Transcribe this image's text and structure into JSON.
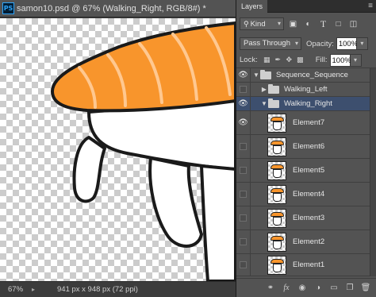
{
  "document": {
    "app_icon": "PS",
    "title": "samon10.psd @ 67% (Walking_Right, RGB/8#) *",
    "zoom": "67%",
    "size_info": "941 px x 948 px (72 ppi)"
  },
  "panel": {
    "tab_label": "Layers",
    "filter": {
      "kind_label": "Kind"
    },
    "blend": {
      "mode": "Pass Through",
      "opacity_label": "Opacity:",
      "opacity_value": "100%",
      "lock_label": "Lock:",
      "fill_label": "Fill:",
      "fill_value": "100%"
    },
    "layers": [
      {
        "name": "Sequence_Sequence",
        "type": "group",
        "expanded": true,
        "visible": true,
        "indent": 0,
        "selected": false
      },
      {
        "name": "Walking_Left",
        "type": "group",
        "expanded": false,
        "visible": false,
        "indent": 1,
        "selected": false
      },
      {
        "name": "Walking_Right",
        "type": "group",
        "expanded": true,
        "visible": true,
        "indent": 1,
        "selected": true
      },
      {
        "name": "Element7",
        "type": "layer",
        "visible": true,
        "indent": 2,
        "selected": false
      },
      {
        "name": "Element6",
        "type": "layer",
        "visible": false,
        "indent": 2,
        "selected": false
      },
      {
        "name": "Element5",
        "type": "layer",
        "visible": false,
        "indent": 2,
        "selected": false
      },
      {
        "name": "Element4",
        "type": "layer",
        "visible": false,
        "indent": 2,
        "selected": false
      },
      {
        "name": "Element3",
        "type": "layer",
        "visible": false,
        "indent": 2,
        "selected": false
      },
      {
        "name": "Element2",
        "type": "layer",
        "visible": false,
        "indent": 2,
        "selected": false
      },
      {
        "name": "Element1",
        "type": "layer",
        "visible": false,
        "indent": 2,
        "selected": false
      }
    ]
  },
  "colors": {
    "salmon": "#f8952c",
    "salmon_stripe": "#ffc890",
    "outline": "#1a1a1a",
    "selection": "#3d4f6e",
    "panel_bg": "#535353"
  },
  "icons": {
    "filter": [
      "image-filter-icon",
      "adjustment-filter-icon",
      "type-filter-icon",
      "shape-filter-icon",
      "smart-object-filter-icon"
    ],
    "lock": [
      "lock-transparent-icon",
      "lock-pixels-icon",
      "lock-position-icon",
      "lock-all-icon"
    ],
    "footer": [
      "link-layers-icon",
      "fx-icon",
      "add-mask-icon",
      "new-adjustment-icon",
      "new-group-icon",
      "new-layer-icon",
      "delete-layer-icon"
    ]
  }
}
